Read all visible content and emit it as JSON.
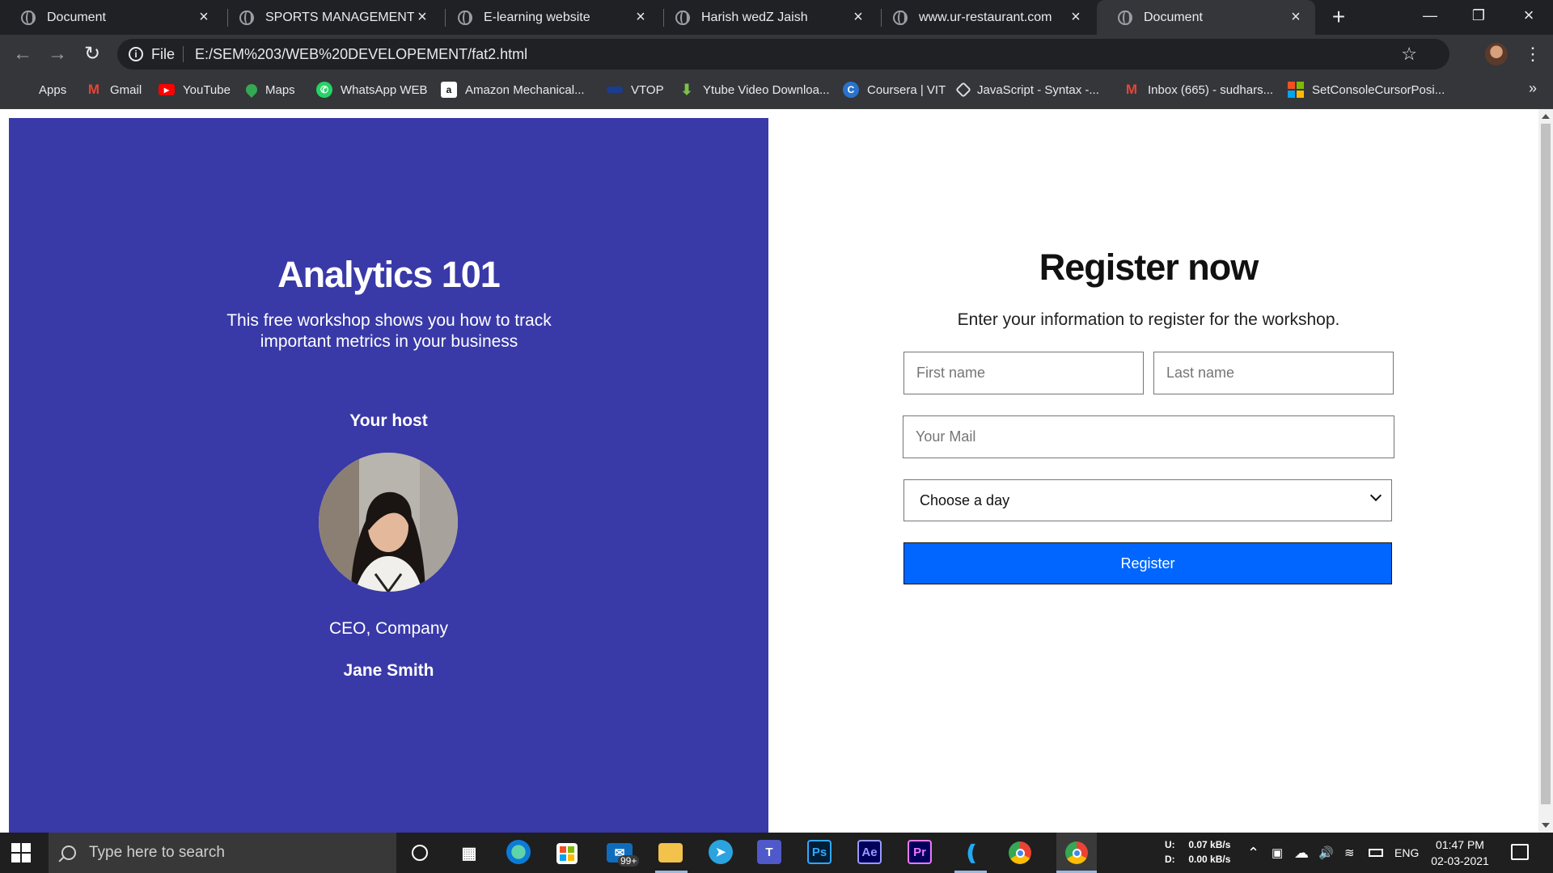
{
  "browser": {
    "tabs": [
      {
        "title": "Document",
        "active": false
      },
      {
        "title": "SPORTS MANAGEMENT SYS",
        "active": false
      },
      {
        "title": "E-learning website",
        "active": false
      },
      {
        "title": "Harish wedZ Jaish",
        "active": false
      },
      {
        "title": "www.ur-restaurant.com",
        "active": false
      },
      {
        "title": "Document",
        "active": true
      }
    ],
    "new_tab_label": "+",
    "address": {
      "scheme_label": "File",
      "url": "E:/SEM%203/WEB%20DEVELOPEMENT/fat2.html"
    },
    "bookmarks": [
      {
        "label": "Apps",
        "icon": "apps-grid-icon",
        "color": "#f28b82"
      },
      {
        "label": "Gmail",
        "icon": "gmail-icon",
        "color": "#ea4335"
      },
      {
        "label": "YouTube",
        "icon": "youtube-icon",
        "color": "#ff0000"
      },
      {
        "label": "Maps",
        "icon": "maps-pin-icon",
        "color": "#34a853"
      },
      {
        "label": "WhatsApp WEB",
        "icon": "whatsapp-icon",
        "color": "#25d366"
      },
      {
        "label": "Amazon Mechanical...",
        "icon": "amazon-icon",
        "color": "#ffffff"
      },
      {
        "label": "VTOP",
        "icon": "vtop-icon",
        "color": "#1a3d8f"
      },
      {
        "label": "Ytube Video Downloa...",
        "icon": "download-arrow-icon",
        "color": "#7cc14a"
      },
      {
        "label": "Coursera | VIT",
        "icon": "coursera-icon",
        "color": "#2a73cc"
      },
      {
        "label": "JavaScript - Syntax -...",
        "icon": "javascript-icon",
        "color": "#dddddd"
      },
      {
        "label": "Inbox (665) - sudhars...",
        "icon": "gmail-icon",
        "color": "#ea4335"
      },
      {
        "label": "SetConsoleCursorPosi...",
        "icon": "microsoft-icon",
        "color": "#f25022"
      }
    ],
    "more_label": "»"
  },
  "page": {
    "left": {
      "title": "Analytics 101",
      "subtitle": "This free workshop shows you how to track important metrics in your business",
      "host_label": "Your host",
      "host_role": "CEO, Company",
      "host_name": "Jane Smith",
      "background": "#3939a8"
    },
    "right": {
      "title": "Register now",
      "subtitle": "Enter your information to register for the workshop.",
      "first_name_placeholder": "First name",
      "last_name_placeholder": "Last name",
      "email_placeholder": "Your Mail",
      "day_select_value": "Choose a day",
      "register_label": "Register",
      "button_color": "#0066ff"
    }
  },
  "taskbar": {
    "search_placeholder": "Type here to search",
    "mail_badge": "99+",
    "net_up_label": "U:",
    "net_up_value": "0.07 kB/s",
    "net_down_label": "D:",
    "net_down_value": "0.00 kB/s",
    "language": "ENG",
    "time": "01:47 PM",
    "date": "02-03-2021"
  }
}
